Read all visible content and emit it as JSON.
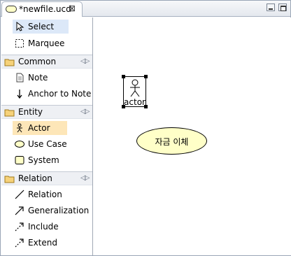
{
  "editor_tab": {
    "title": "*newfile.ucd",
    "close_glyph": "⊠"
  },
  "palette": {
    "tools": [
      {
        "label": "Select",
        "icon": "arrow-cursor-icon"
      },
      {
        "label": "Marquee",
        "icon": "marquee-icon"
      }
    ],
    "drawers": [
      {
        "label": "Common",
        "items": [
          {
            "label": "Note",
            "icon": "note-icon"
          },
          {
            "label": "Anchor to Note",
            "icon": "anchor-arrow-icon"
          }
        ]
      },
      {
        "label": "Entity",
        "items": [
          {
            "label": "Actor",
            "icon": "actor-icon"
          },
          {
            "label": "Use Case",
            "icon": "usecase-icon"
          },
          {
            "label": "System",
            "icon": "system-icon"
          }
        ]
      },
      {
        "label": "Relation",
        "items": [
          {
            "label": "Relation",
            "icon": "line-icon"
          },
          {
            "label": "Generalization",
            "icon": "generalization-icon"
          },
          {
            "label": "Include",
            "icon": "include-icon"
          },
          {
            "label": "Extend",
            "icon": "extend-icon"
          }
        ]
      }
    ],
    "collapse_glyph": "◁▷"
  },
  "diagram": {
    "actor": {
      "name": "actor"
    },
    "usecase": {
      "name": "자금 이체"
    }
  },
  "colors": {
    "selected_tool": "#dce8f8",
    "selected_entity": "#fde6b8",
    "usecase_fill": "#ffffc8"
  }
}
